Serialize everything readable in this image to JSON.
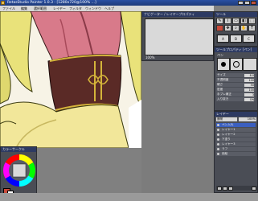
{
  "window": {
    "title": "RetasStudio Painter 1.0.3 - [1280x720@100% ...]"
  },
  "menu": [
    "ファイル",
    "編集",
    "選択範囲",
    "レイヤー",
    "フィルタ",
    "ウィンドウ",
    "ヘルプ"
  ],
  "navigator": {
    "title": "ナビゲーター / レイヤープロパティ",
    "zoom": "100%"
  },
  "tools": {
    "title": "ツール",
    "labels": [
      "A",
      "B",
      "C"
    ]
  },
  "tool_property": {
    "title": "ツールプロパティ [ペン]",
    "tool_name": "ペン",
    "rows": [
      {
        "label": "サイズ",
        "value": "8.0"
      },
      {
        "label": "不透明度",
        "value": "100"
      },
      {
        "label": "硬さ",
        "value": "50"
      },
      {
        "label": "密度",
        "value": "100"
      },
      {
        "label": "手ブレ補正",
        "value": "3"
      },
      {
        "label": "入り抜き",
        "value": "ON"
      }
    ]
  },
  "layers": {
    "title": "レイヤー",
    "mode": "通常",
    "opacity": "100%",
    "items": [
      "ペン入れ",
      "レイヤー1",
      "レイヤー2",
      "下塗り",
      "レイヤー3",
      "ラフ",
      "用紙"
    ]
  },
  "color": {
    "title": "カラーサークル"
  },
  "colors": {
    "accent": "#2d3a62",
    "skin": "#f2e79a",
    "corset": "#5a2a26",
    "cloth": "#d87a8a"
  }
}
